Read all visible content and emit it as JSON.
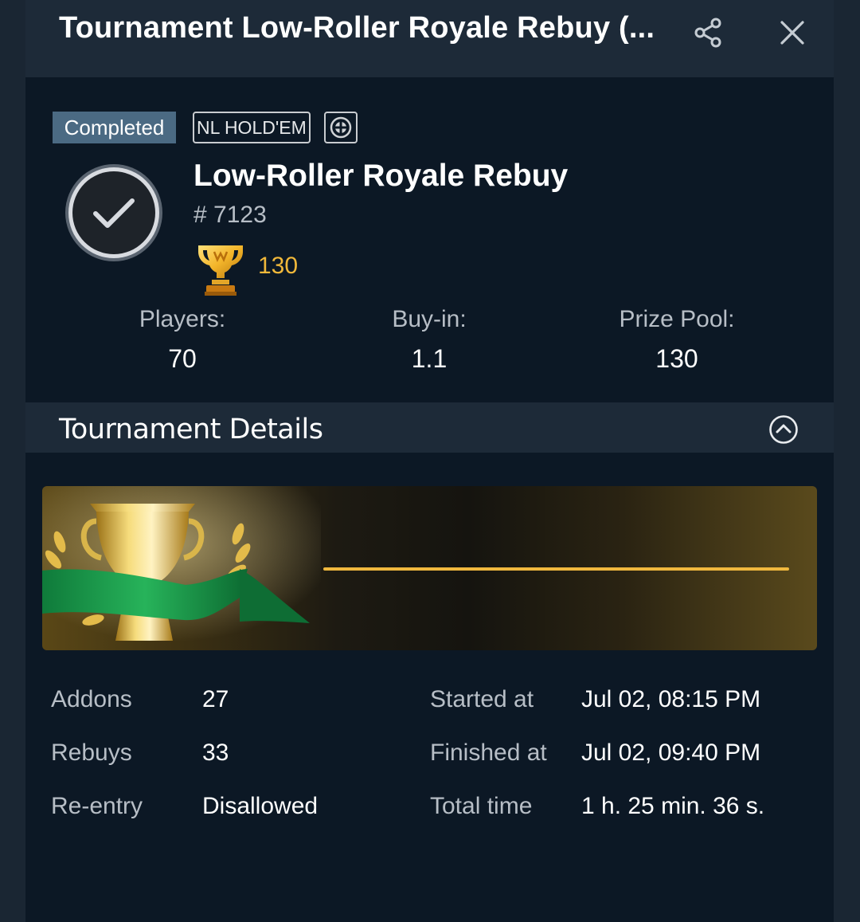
{
  "header": {
    "title": "Tournament Low-Roller Royale Rebuy (..."
  },
  "summary": {
    "status": "Completed",
    "game_type": "NL HOLD'EM",
    "name": "Low-Roller Royale Rebuy",
    "id": "# 7123",
    "trophy_letter": "W",
    "prize": "130",
    "stats": [
      {
        "label": "Players:",
        "value": "70"
      },
      {
        "label": "Buy-in:",
        "value": "1.1"
      },
      {
        "label": "Prize Pool:",
        "value": "130"
      }
    ]
  },
  "details": {
    "section_title": "Tournament Details",
    "left": [
      {
        "label": "Addons",
        "value": "27"
      },
      {
        "label": "Rebuys",
        "value": "33"
      },
      {
        "label": "Re-entry",
        "value": "Disallowed"
      }
    ],
    "right": [
      {
        "label": "Started at",
        "value": "Jul 02, 08:15 PM"
      },
      {
        "label": "Finished at",
        "value": "Jul 02, 09:40 PM"
      },
      {
        "label": "Total time",
        "value": "1 h. 25 min. 36 s."
      }
    ]
  },
  "colors": {
    "accent_gold": "#f1b83a",
    "status_badge": "#4b6a83",
    "panel_bg": "#0c1825",
    "header_bg": "#1d2a38"
  },
  "icons": {
    "share": "share-icon",
    "close": "close-icon",
    "fold": "game-option-icon",
    "status": "check-circle-icon",
    "trophy": "trophy-icon",
    "collapse": "chevron-up-circle-icon"
  }
}
